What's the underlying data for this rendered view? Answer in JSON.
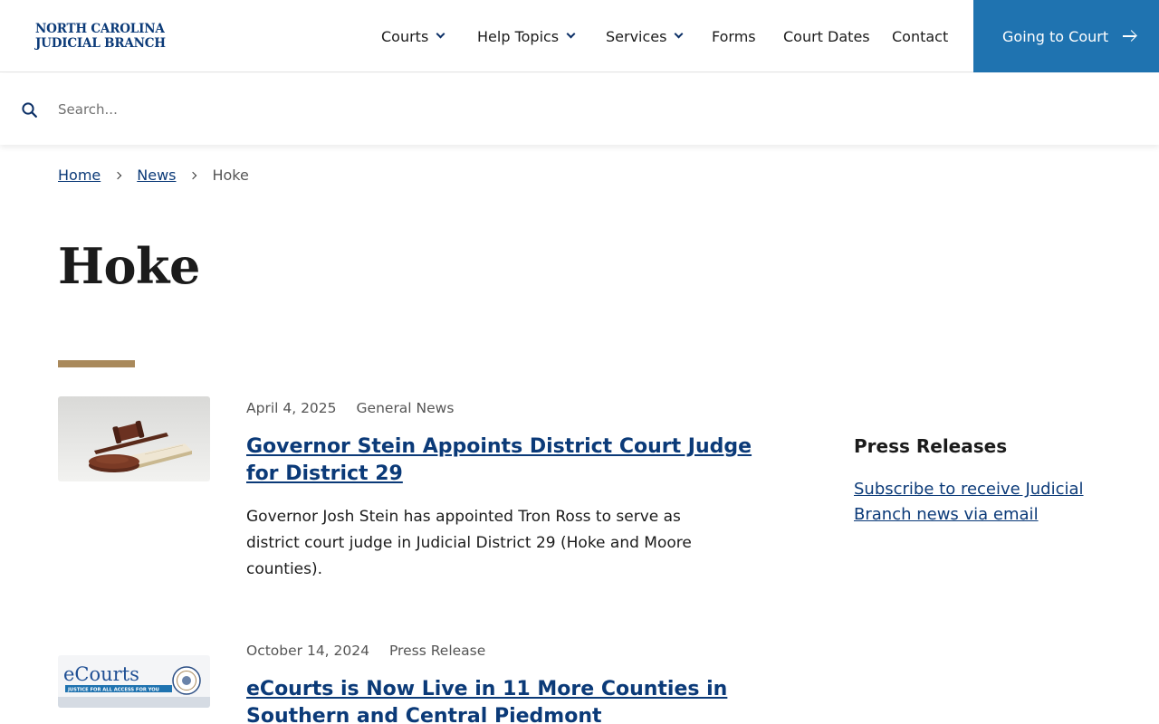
{
  "header": {
    "logo_line1": "NORTH CAROLINA",
    "logo_line2": "JUDICIAL BRANCH",
    "nav": [
      {
        "label": "Courts",
        "dropdown": true
      },
      {
        "label": "Help Topics",
        "dropdown": true
      },
      {
        "label": "Services",
        "dropdown": true
      },
      {
        "label": "Forms",
        "dropdown": false
      },
      {
        "label": "Court Dates",
        "dropdown": false
      },
      {
        "label": "Contact",
        "dropdown": false
      }
    ],
    "cta_label": "Going to Court",
    "cta_color": "#1f73b0"
  },
  "search": {
    "placeholder": "Search...",
    "value": ""
  },
  "breadcrumb": {
    "home": "Home",
    "news": "News",
    "current": "Hoke"
  },
  "page": {
    "title": "Hoke",
    "accent_color": "#a9895b"
  },
  "articles": [
    {
      "date": "April 4, 2025",
      "category": "General News",
      "title": "Governor Stein Appoints District Court Judge for District 29",
      "summary": "Governor Josh Stein has appointed Tron Ross to serve as district court judge in Judicial District 29 (Hoke and Moore counties).",
      "thumb_icon": "gavel-image"
    },
    {
      "date": "October 14, 2024",
      "category": "Press Release",
      "title": "eCourts is Now Live in 11 More Counties in Southern and Central Piedmont",
      "thumb_icon": "ecourts-logo-image",
      "thumb_brand": "eCourts",
      "thumb_tagline": "JUSTICE FOR ALL ACCESS FOR YOU"
    }
  ],
  "sidebar": {
    "heading": "Press Releases",
    "link": "Subscribe to receive Judicial Branch news via email"
  }
}
